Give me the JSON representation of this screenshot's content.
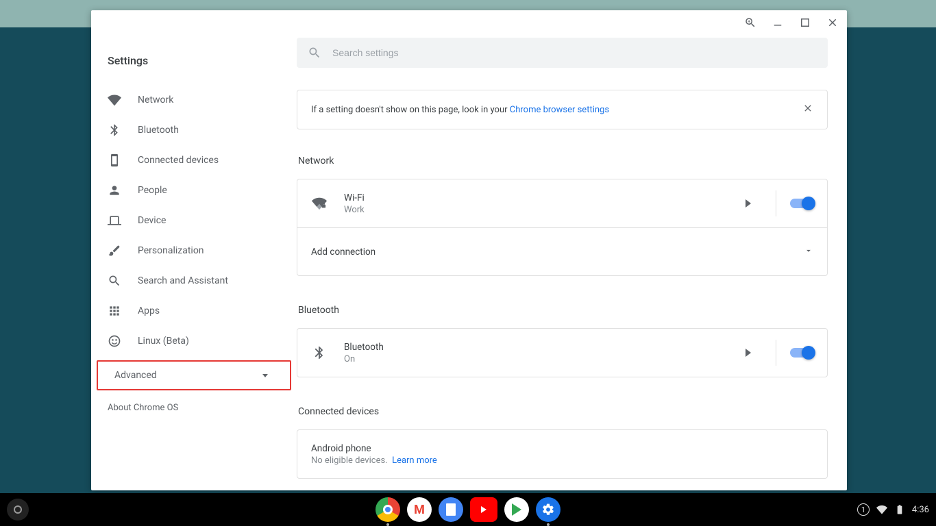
{
  "window": {
    "title": "Settings"
  },
  "sidebar": {
    "items": [
      {
        "label": "Network"
      },
      {
        "label": "Bluetooth"
      },
      {
        "label": "Connected devices"
      },
      {
        "label": "People"
      },
      {
        "label": "Device"
      },
      {
        "label": "Personalization"
      },
      {
        "label": "Search and Assistant"
      },
      {
        "label": "Apps"
      },
      {
        "label": "Linux (Beta)"
      }
    ],
    "advanced_label": "Advanced",
    "about_label": "About Chrome OS"
  },
  "search": {
    "placeholder": "Search settings"
  },
  "banner": {
    "text": "If a setting doesn't show on this page, look in your ",
    "link": "Chrome browser settings"
  },
  "sections": {
    "network": {
      "title": "Network",
      "wifi": {
        "title": "Wi-Fi",
        "name": "Work"
      },
      "add": "Add connection"
    },
    "bluetooth": {
      "title": "Bluetooth",
      "item": {
        "title": "Bluetooth",
        "status": "On"
      }
    },
    "connected": {
      "title": "Connected devices",
      "item": {
        "title": "Android phone",
        "status": "No eligible devices.",
        "link": "Learn more"
      }
    }
  },
  "tray": {
    "notifications": "1",
    "time": "4:36"
  }
}
